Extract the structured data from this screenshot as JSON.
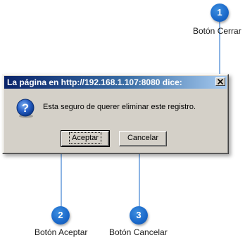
{
  "dialog": {
    "title": "La página en http://192.168.1.107:8080 dice:",
    "message": "Esta seguro de querer eliminar este registro.",
    "icon": "question-icon",
    "buttons": {
      "accept": "Aceptar",
      "cancel": "Cancelar"
    }
  },
  "callouts": [
    {
      "number": "1",
      "label": "Botón Cerrar"
    },
    {
      "number": "2",
      "label": "Botón Aceptar"
    },
    {
      "number": "3",
      "label": "Botón Cancelar"
    }
  ],
  "colors": {
    "callout": "#1a68c9",
    "titlebar_start": "#0a246a",
    "titlebar_end": "#a6caf0",
    "dialog_face": "#d4d0c8"
  }
}
